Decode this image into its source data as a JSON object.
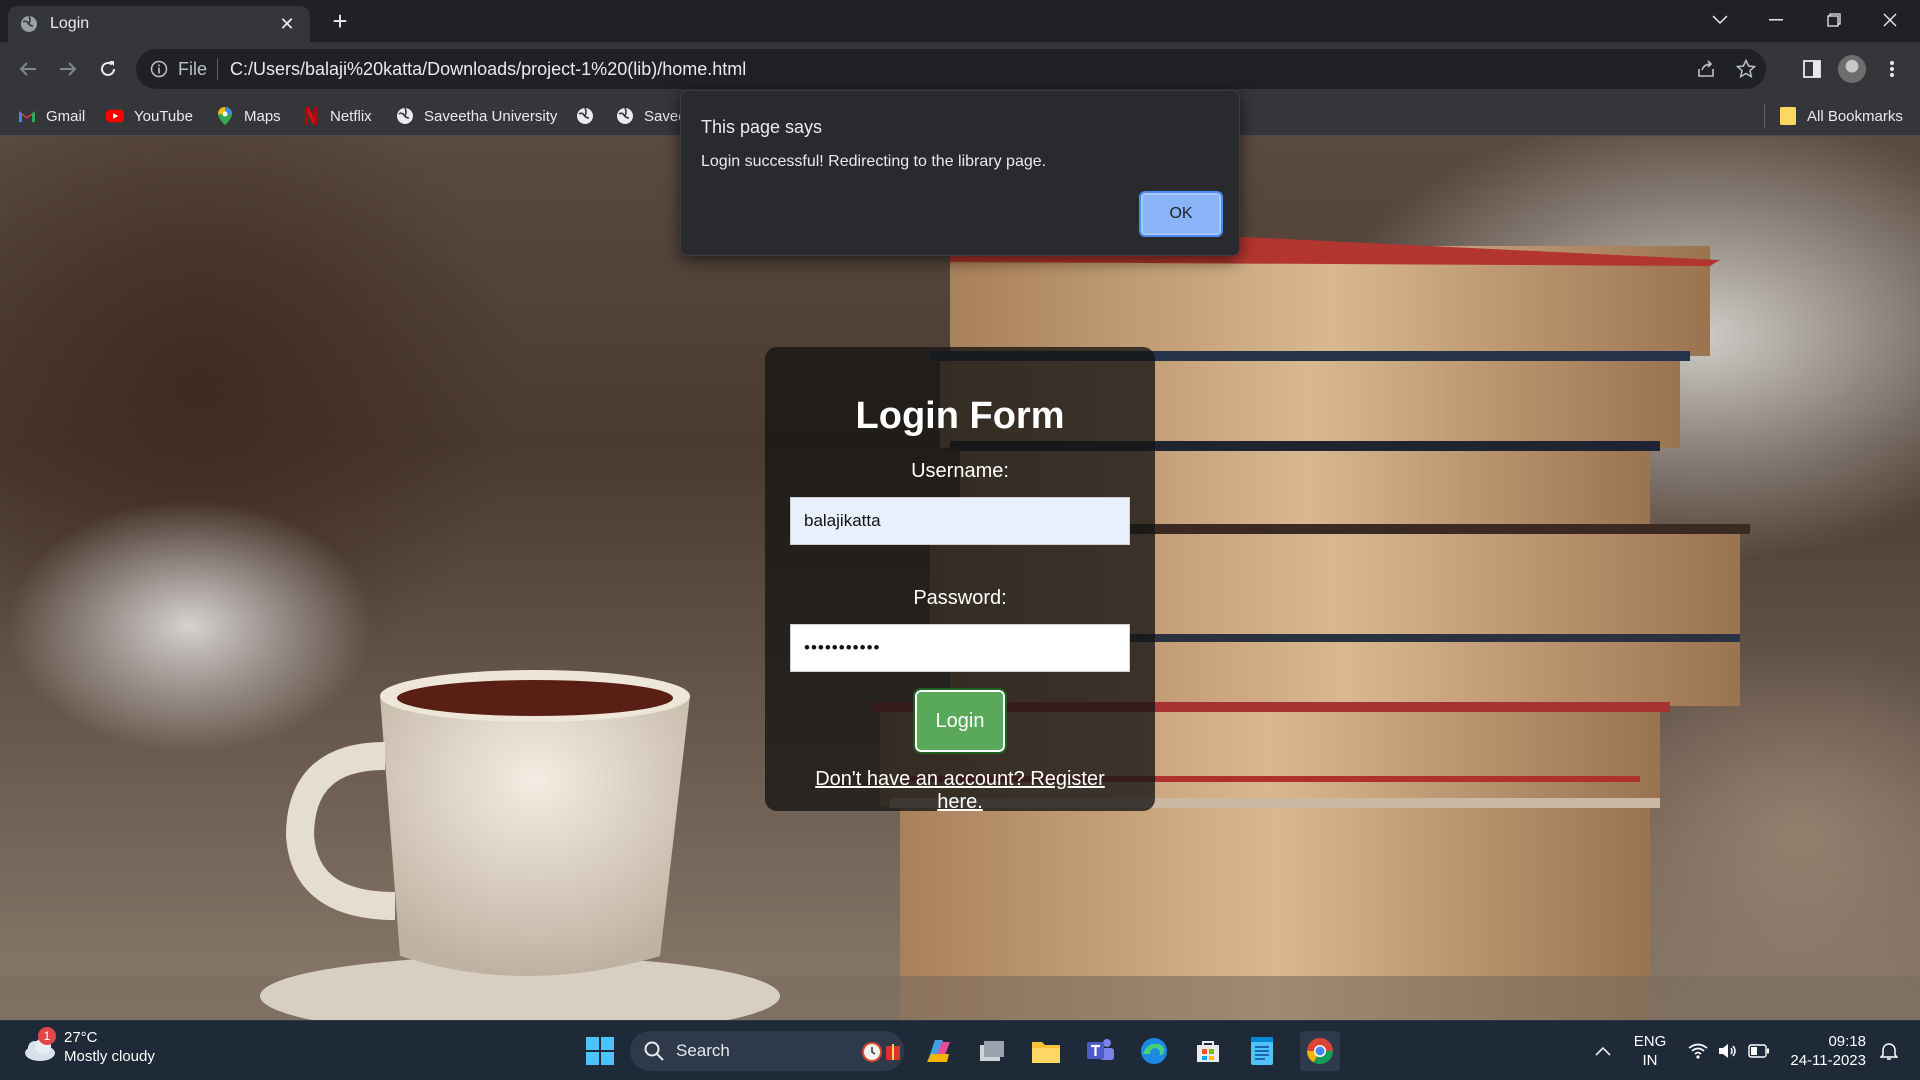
{
  "browser": {
    "tab_title": "Login",
    "omnibox_scheme": "File",
    "url": "C:/Users/balaji%20katta/Downloads/project-1%20(lib)/home.html"
  },
  "bookmarks": {
    "items": [
      {
        "label": "Gmail",
        "icon": "gmail-icon"
      },
      {
        "label": "YouTube",
        "icon": "youtube-icon"
      },
      {
        "label": "Maps",
        "icon": "maps-icon"
      },
      {
        "label": "Netflix",
        "icon": "netflix-icon"
      },
      {
        "label": "Saveetha University",
        "icon": "globe-icon"
      },
      {
        "label": "",
        "icon": "globe-icon"
      },
      {
        "label": "Savee",
        "icon": "globe-icon"
      }
    ],
    "all_bookmarks_label": "All Bookmarks"
  },
  "dialog": {
    "title": "This page says",
    "message": "Login successful! Redirecting to the library page.",
    "ok_label": "OK"
  },
  "login_form": {
    "heading": "Login Form",
    "username_label": "Username:",
    "username_value": "balajikatta",
    "password_label": "Password:",
    "password_value": "•••••••••••",
    "login_button": "Login",
    "register_link": "Don't have an account? Register here."
  },
  "taskbar": {
    "weather_temp": "27°C",
    "weather_condition": "Mostly cloudy",
    "weather_badge": "1",
    "search_label": "Search",
    "language_top": "ENG",
    "language_bottom": "IN",
    "time": "09:18",
    "date": "24-11-2023"
  },
  "colors": {
    "browser_frame": "#202124",
    "toolbar": "#35363a",
    "login_button": "#5aa85a",
    "dialog_ok": "#8ab4f8",
    "taskbar": "#1f2a38"
  }
}
